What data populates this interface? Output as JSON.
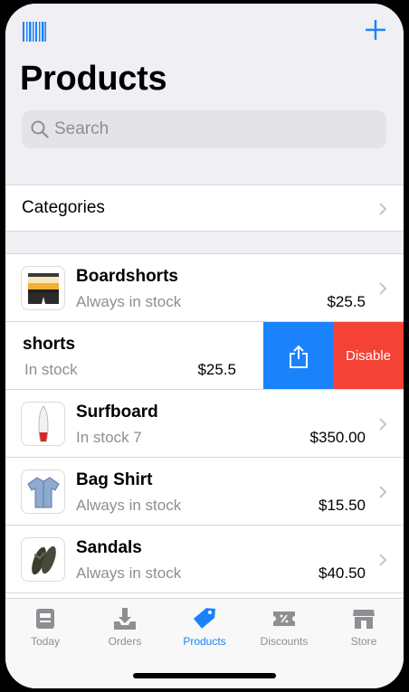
{
  "header": {
    "title": "Products"
  },
  "search": {
    "placeholder": "Search"
  },
  "categories": {
    "label": "Categories"
  },
  "products": [
    {
      "name": "Boardshorts",
      "stock": "Always in stock",
      "price": "$25.5"
    },
    {
      "name": "shorts",
      "stock": "In stock",
      "price": "$25.5"
    },
    {
      "name": "Surfboard",
      "stock": "In stock 7",
      "price": "$350.00"
    },
    {
      "name": "Bag Shirt",
      "stock": "Always in stock",
      "price": "$15.50"
    },
    {
      "name": "Sandals",
      "stock": "Always in stock",
      "price": "$40.50"
    }
  ],
  "swipe_actions": {
    "disable_label": "Disable"
  },
  "tabbar": {
    "tabs": [
      {
        "label": "Today",
        "icon": "today-icon"
      },
      {
        "label": "Orders",
        "icon": "orders-icon"
      },
      {
        "label": "Products",
        "icon": "tag-icon",
        "active": true
      },
      {
        "label": "Discounts",
        "icon": "discount-icon"
      },
      {
        "label": "Store",
        "icon": "store-icon"
      }
    ]
  },
  "colors": {
    "accent": "#1a82fb",
    "destructive": "#f44336",
    "secondary_text": "#8e8e93"
  }
}
